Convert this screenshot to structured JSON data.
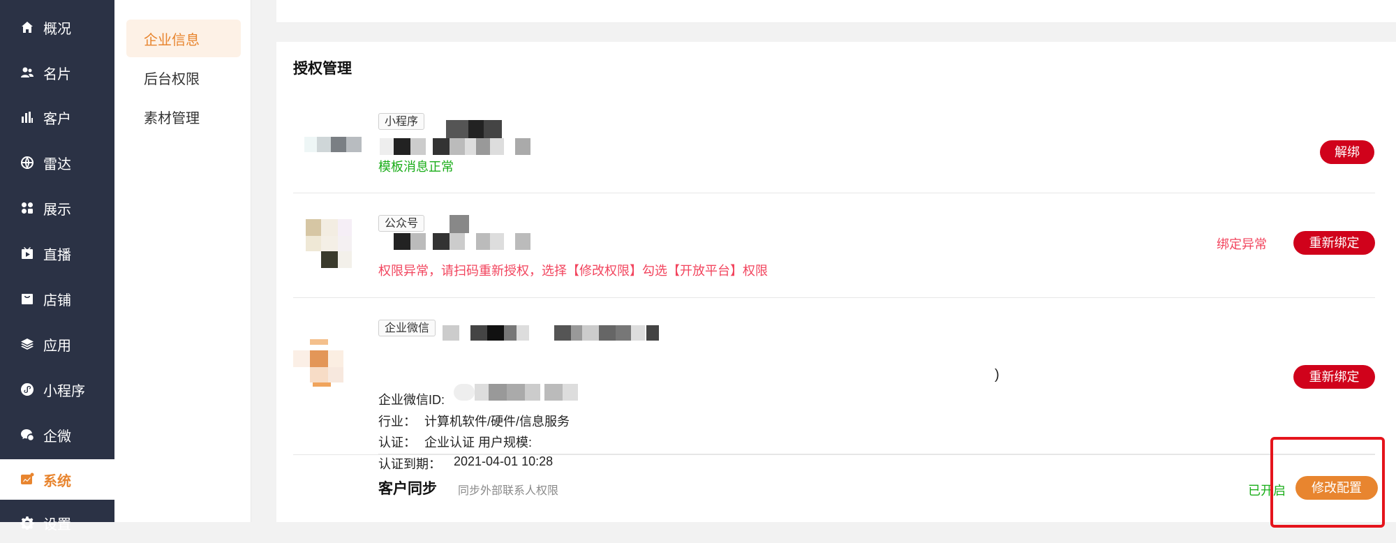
{
  "sidebar": {
    "items": [
      {
        "label": "概况",
        "icon": "home-icon"
      },
      {
        "label": "名片",
        "icon": "contacts-icon"
      },
      {
        "label": "客户",
        "icon": "chart-icon"
      },
      {
        "label": "雷达",
        "icon": "globe-icon"
      },
      {
        "label": "展示",
        "icon": "grid-icon"
      },
      {
        "label": "直播",
        "icon": "tv-icon"
      },
      {
        "label": "店铺",
        "icon": "shop-icon"
      },
      {
        "label": "应用",
        "icon": "layers-icon"
      },
      {
        "label": "小程序",
        "icon": "miniprogram-icon"
      },
      {
        "label": "企微",
        "icon": "wecom-icon"
      },
      {
        "label": "系统",
        "icon": "system-icon"
      },
      {
        "label": "设置",
        "icon": "settings-icon"
      }
    ],
    "active": "系统"
  },
  "subnav": {
    "items": [
      "企业信息",
      "后台权限",
      "素材管理"
    ],
    "active": "企业信息"
  },
  "auth": {
    "title": "授权管理",
    "miniprogram": {
      "tag": "小程序",
      "status": "模板消息正常",
      "button": "解绑"
    },
    "official_account": {
      "tag": "公众号",
      "status": "权限异常，请扫码重新授权，选择【修改权限】勾选【开放平台】权限",
      "warning": "绑定异常",
      "button": "重新绑定"
    },
    "wecom": {
      "tag": "企业微信",
      "name_suffix": ")",
      "id_label": "企业微信ID:",
      "industry_label": "行业：",
      "industry_value": "计算机软件/硬件/信息服务",
      "cert_label": "认证：",
      "cert_value": "企业认证 用户规模:",
      "expire_label": "认证到期：",
      "expire_value": "2021-04-01 10:28",
      "button": "重新绑定"
    },
    "customer_sync": {
      "title": "客户同步",
      "desc": "同步外部联系人权限",
      "state": "已开启",
      "button": "修改配置"
    }
  },
  "colors": {
    "sidebar_bg": "#2b3245",
    "accent": "#e8852f",
    "danger": "#d0021b",
    "success": "#1aad19",
    "error_text": "#f2455e"
  }
}
